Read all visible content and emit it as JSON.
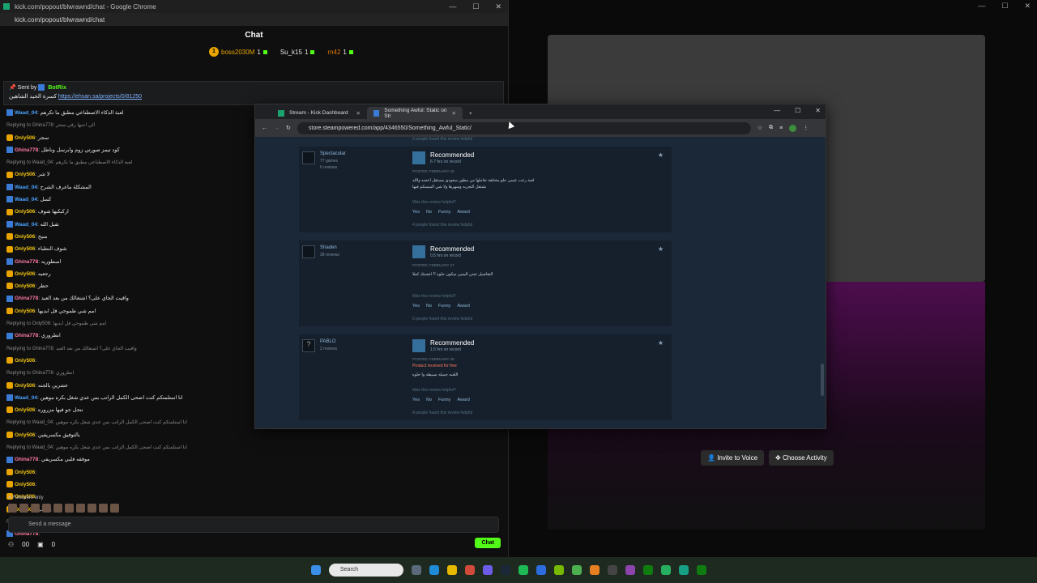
{
  "chat_window": {
    "title": "kick.com/popout/blwrawnd/chat - Google Chrome",
    "url": "kick.com/popout/blwrawnd/chat",
    "header": "Chat",
    "leaderboard": [
      {
        "name": "boss2030M",
        "count": "1"
      },
      {
        "name": "Su_k15",
        "count": "1"
      },
      {
        "name": "rn42",
        "count": "1"
      }
    ],
    "pinned": {
      "sent_by_label": "Sent by",
      "sender": "BotRix",
      "text": "كسرة الحيد الشاهين",
      "link": "https://ehsan.sa/projects/0/81250"
    },
    "messages": [
      {
        "user": "Waad_04",
        "color": "blue",
        "text": "لعبة الذكاء الاصطناعي مطبق ما تكرهم"
      },
      {
        "reply": "Replying to Ghina778: الي احبها رقي سجر"
      },
      {
        "user": "Only506",
        "color": "yellow",
        "text": "سجر"
      },
      {
        "user": "Ghina778",
        "color": "pink",
        "text": "كود تيمز صورتي زوم وابرسل وناطل"
      },
      {
        "reply": "Replying to Waad_04: لعبة الذكاء الاصطناعي مطبق ما تكرهم"
      },
      {
        "user": "Only506",
        "color": "yellow",
        "text": "لا شر"
      },
      {
        "user": "Waad_04",
        "color": "blue",
        "text": "المشكلة ماعرف الشرح"
      },
      {
        "user": "Waad_04",
        "color": "blue",
        "text": "كسل"
      },
      {
        "user": "Only506",
        "color": "yellow",
        "text": "اركبكيها شوف"
      },
      {
        "user": "Waad_04",
        "color": "blue",
        "text": "تقبل الله"
      },
      {
        "user": "Only506",
        "color": "yellow",
        "text": "منيح"
      },
      {
        "user": "Only506",
        "color": "yellow",
        "text": "شوف النطباء"
      },
      {
        "user": "Ghina778",
        "color": "pink",
        "text": "اسطوريه"
      },
      {
        "user": "Only506",
        "color": "yellow",
        "text": "رجعيه"
      },
      {
        "user": "Only506",
        "color": "yellow",
        "text": "حظر"
      },
      {
        "user": "Ghina778",
        "color": "pink",
        "text": "واقيت الجاي على؟ اشتغالك من بعد العيد"
      },
      {
        "user": "Only506",
        "color": "yellow",
        "text": "امم شي طموحي فل ابديها"
      },
      {
        "reply": "Replying to Only506: امم شي طموحي فل ابديها"
      },
      {
        "user": "Ghina778",
        "color": "pink",
        "text": "انطروري"
      },
      {
        "reply": "Replying to Ghina778: واقيت الجاي على؟ اشتغالك من بعد العيد"
      },
      {
        "user": "Only506",
        "color": "yellow",
        "text": ""
      },
      {
        "reply": "Replying to Ghina778: انطروري"
      },
      {
        "user": "Only506",
        "color": "yellow",
        "text": "عشرين بالجنه"
      },
      {
        "user": "Waad_04",
        "color": "blue",
        "text": "انا استلمتكم كنت اضحى الكمل الراتب بس عدي شغل بكره موهين"
      },
      {
        "user": "Only506",
        "color": "yellow",
        "text": "تنحل جو فيها مزروره"
      },
      {
        "reply": "Replying to Waad_04: انا استلمتكم كنت اضحى الكمل الراتب بس عدي شغل بكره موهين"
      },
      {
        "user": "Only506",
        "color": "yellow",
        "text": "بالتوفيق مكسريفين"
      },
      {
        "reply": "Replying to Waad_04: انا استلمتكم كنت اضحى الكمل الراتب بس عدي شغل بكره موهين"
      },
      {
        "user": "Ghina778",
        "color": "pink",
        "text": "موفقه فلبي مكسريفي"
      },
      {
        "user": "Only506",
        "color": "yellow",
        "text": ""
      },
      {
        "user": "Only506",
        "color": "yellow",
        "text": ""
      },
      {
        "user": "Only506",
        "color": "yellow",
        "text": ""
      },
      {
        "user": "Only506",
        "color": "yellow",
        "text": "بقربب"
      },
      {
        "reply": "Replying to Only506: بقربب"
      },
      {
        "user": "Ghina778",
        "color": "pink",
        "text": ""
      }
    ],
    "followers_only": "Followers only",
    "send_placeholder": "Send a message",
    "viewers": "00",
    "gifts": "0",
    "chat_button": "Chat"
  },
  "steam_window": {
    "tabs": [
      {
        "label": "Stream - Kick Dashboard",
        "active": false
      },
      {
        "label": "Something Awful: Static on Str",
        "active": true
      }
    ],
    "url": "store.steampowered.com/app/4346550/Something_Awful_Static/",
    "top_note": "2 people found this review helpful",
    "reviews": [
      {
        "name": "Spectacular",
        "meta1": "77 games",
        "meta2": "6 reviews",
        "recommendation": "Recommended",
        "hours": "6.7 hrs on record",
        "posted": "POSTED: FEBRUARY 28",
        "free_note": "",
        "text": "لعبة رعب عسى حلو مختلفة تعاملها من مطور سعودي مستقل اعجبه والله نشتغل التجربه وسهرها ولا شي السمنكم فيها",
        "helpful_q": "Was this review helpful?",
        "yes": "Yes",
        "no": "No",
        "funny": "Funny",
        "award": "Award",
        "found": "4 people found this review helpful"
      },
      {
        "name": "Shaden",
        "meta1": "28 reviews",
        "meta2": "",
        "recommendation": "Recommended",
        "hours": "0.5 hrs on record",
        "posted": "POSTED: FEBRUARY 27",
        "free_note": "",
        "text": "التفاصيل تجنن اليمين ميكون حلوه !! اعجبتك كملا",
        "helpful_q": "Was this review helpful?",
        "yes": "Yes",
        "no": "No",
        "funny": "Funny",
        "award": "Award",
        "found": "5 people found this review helpful"
      },
      {
        "name": "PABLO",
        "meta1": "2 reviews",
        "meta2": "",
        "recommendation": "Recommended",
        "hours": "1.5 hrs on record",
        "posted": "POSTED: FEBRUARY 28",
        "free_note": "Product received for free",
        "text": "اللعبه جميله بسيطه وا حلوه",
        "helpful_q": "Was this review helpful?",
        "yes": "Yes",
        "no": "No",
        "funny": "Funny",
        "award": "Award",
        "found": "4 people found this review helpful"
      }
    ]
  },
  "right_window": {
    "invite_button": "Invite to Voice",
    "activity_button": "Choose Activity"
  },
  "taskbar": {
    "search_placeholder": "Search"
  }
}
